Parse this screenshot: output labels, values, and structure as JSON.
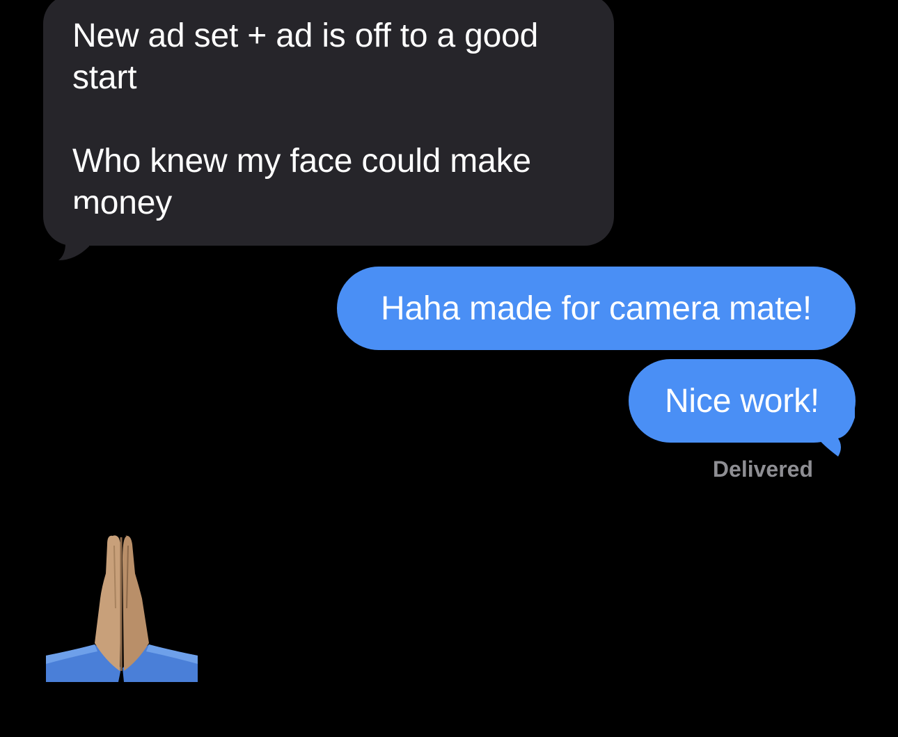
{
  "conversation": {
    "incoming": {
      "line1": "New ad set + ad is off to a good",
      "line2": "start",
      "line3": "Who knew my face could make",
      "line4": "money"
    },
    "outgoing": [
      {
        "text": "Haha made for camera mate!"
      },
      {
        "text": "Nice work!"
      }
    ],
    "status": "Delivered",
    "reaction_emoji": "praying-hands-icon"
  },
  "colors": {
    "background": "#000000",
    "incoming_bubble": "#26252a",
    "outgoing_bubble": "#4a8ff5",
    "status_text": "#8e8e93"
  }
}
